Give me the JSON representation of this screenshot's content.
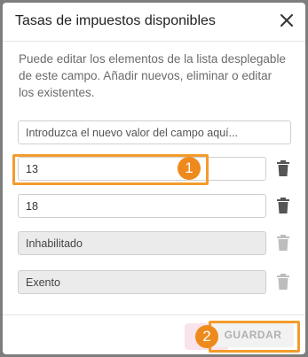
{
  "dialog": {
    "title": "Tasas de impuestos disponibles",
    "description": "Puede editar los elementos de la lista desplegable de este campo. Añadir nuevos, eliminar o editar los existentes.",
    "new_value_placeholder": "Introduzca el nuevo valor del campo aquí...",
    "close_icon": "close-icon",
    "trash_icon": "trash-icon",
    "save_label": "GUARDAR"
  },
  "rates": [
    {
      "value": "13",
      "disabled": false
    },
    {
      "value": "18",
      "disabled": false
    },
    {
      "value": "Inhabilitado",
      "disabled": true
    },
    {
      "value": "Exento",
      "disabled": true
    }
  ],
  "callouts": [
    {
      "number": "1"
    },
    {
      "number": "2"
    }
  ],
  "colors": {
    "callout": "#ee8a1c",
    "highlight": "#f29c2b",
    "trash_enabled": "#555555",
    "trash_disabled": "#bdbdbd"
  }
}
